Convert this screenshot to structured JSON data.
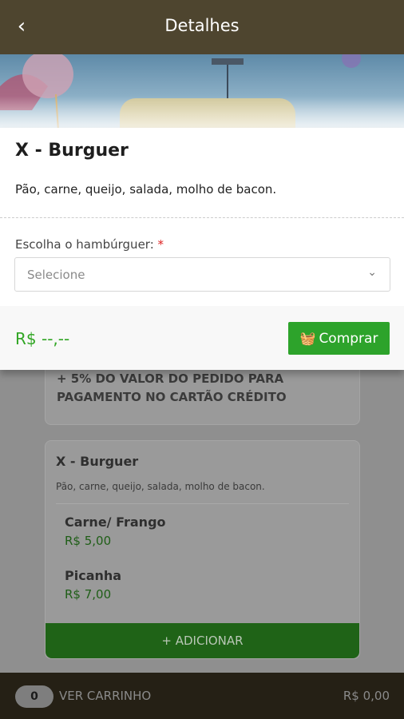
{
  "header": {
    "title": "Detalhes",
    "back_icon": "chevron-left-icon"
  },
  "product": {
    "name": "X - Burguer",
    "description": "Pão, carne, queijo, salada, molho de bacon.",
    "choose_label": "Escolha o hambúrguer:",
    "required_mark": "*",
    "select_placeholder": "Selecione",
    "price": "R$ --,--",
    "buy_label": "Comprar"
  },
  "background": {
    "promo_text": "+ 5% DO VALOR DO PEDIDO PARA PAGAMENTO NO CARTÃO CRÉDITO",
    "card_title": "X - Burguer",
    "card_desc": "Pão, carne, queijo, salada, molho de bacon.",
    "options": [
      {
        "name": "Carne/ Frango",
        "price": "R$ 5,00"
      },
      {
        "name": "Picanha",
        "price": "R$ 7,00"
      }
    ],
    "add_label": "+ ADICIONAR"
  },
  "cart": {
    "count": "0",
    "label": "VER CARRINHO",
    "total": "R$ 0,00"
  },
  "colors": {
    "primary": "#4e452f",
    "accent_green": "#2da32b",
    "price_green": "#31a624"
  }
}
